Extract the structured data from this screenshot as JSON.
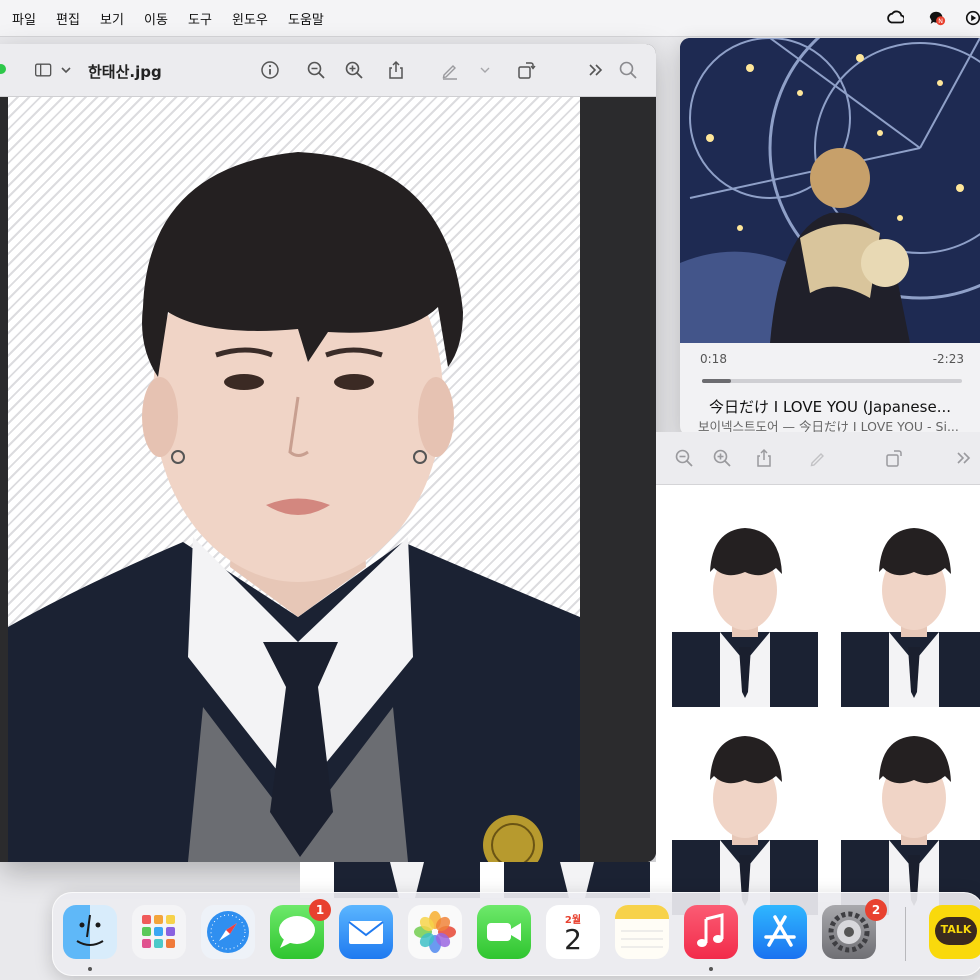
{
  "menubar": {
    "items": [
      "파일",
      "편집",
      "보기",
      "이동",
      "도구",
      "윈도우",
      "도움말"
    ]
  },
  "preview": {
    "filename": "한태산.jpg",
    "icons": [
      "sidebar-icon",
      "info-icon",
      "zoom-out-icon",
      "zoom-in-icon",
      "share-icon",
      "markup-icon",
      "rotate-icon",
      "more-icon",
      "search-icon"
    ]
  },
  "music": {
    "elapsed": "0:18",
    "remaining": "-2:23",
    "progress": 0.11,
    "title": "今日だけ I LOVE YOU (Japanese...",
    "subtitle": "보이넥스트도어 — 今日だけ I LOVE YOU - Si..."
  },
  "dock": {
    "apps": [
      {
        "name": "Finder",
        "icon": "finder-icon"
      },
      {
        "name": "Launchpad",
        "icon": "launchpad-icon"
      },
      {
        "name": "Safari",
        "icon": "safari-icon"
      },
      {
        "name": "Messages",
        "icon": "messages-icon",
        "badge": "1"
      },
      {
        "name": "Mail",
        "icon": "mail-icon"
      },
      {
        "name": "Photos",
        "icon": "photos-icon"
      },
      {
        "name": "FaceTime",
        "icon": "facetime-icon"
      },
      {
        "name": "Calendar",
        "icon": "calendar-icon",
        "month": "2월",
        "day": "2"
      },
      {
        "name": "Notes",
        "icon": "notes-icon"
      },
      {
        "name": "Music",
        "icon": "music-icon"
      },
      {
        "name": "App Store",
        "icon": "app-store-icon"
      },
      {
        "name": "System Settings",
        "icon": "settings-icon",
        "badge": "2"
      },
      {
        "name": "KakaoTalk",
        "icon": "kakaotalk-icon",
        "label": "TALK"
      }
    ]
  },
  "colors": {
    "badge": "#e8412f",
    "blazer": "#1b2233",
    "hair": "#242021"
  }
}
